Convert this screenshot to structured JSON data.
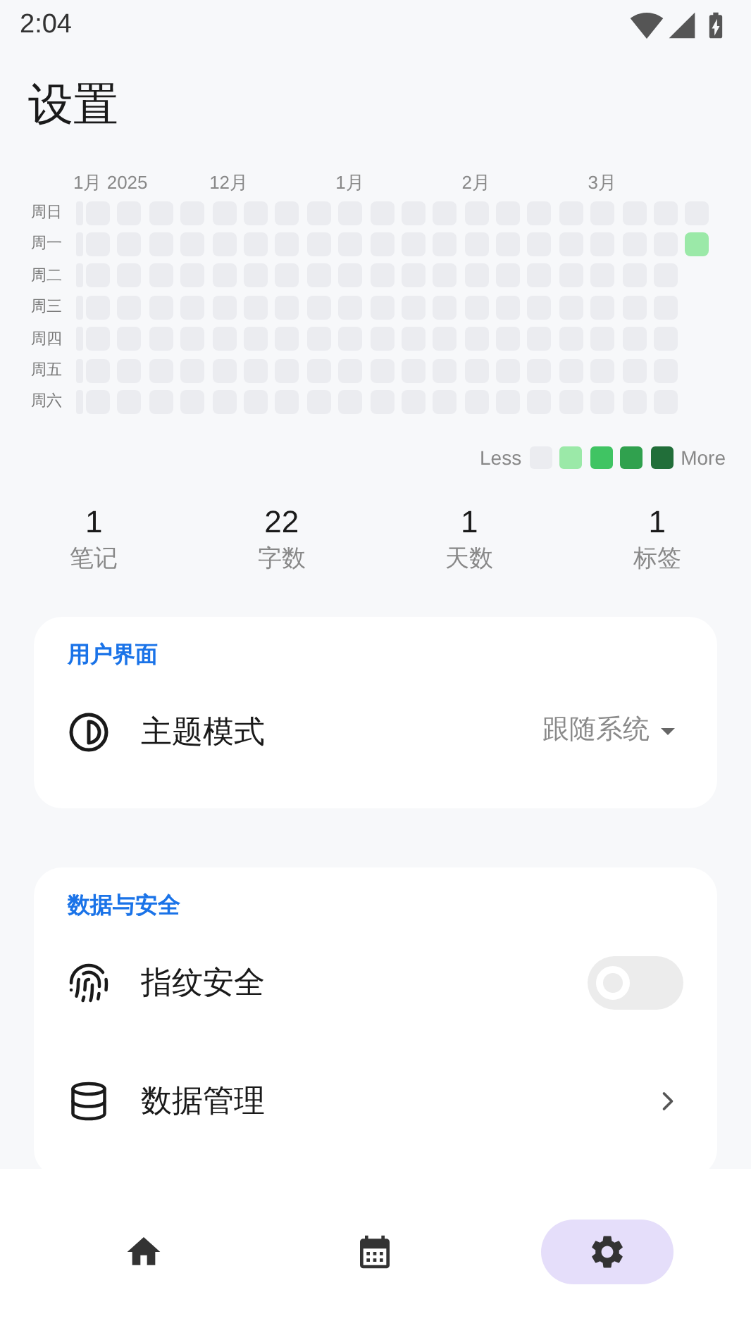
{
  "status_bar": {
    "time": "2:04"
  },
  "title": "设置",
  "heatmap": {
    "weekdays": [
      "周日",
      "周一",
      "周二",
      "周三",
      "周四",
      "周五",
      "周六"
    ],
    "weeks": [
      {
        "month_label": "1月 2025",
        "cells": [
          {
            "color": "#ebecf0"
          },
          {
            "color": "#ebecf0"
          },
          {
            "color": "#ebecf0"
          },
          {
            "color": "#ebecf0"
          },
          {
            "color": "#ebecf0"
          },
          {
            "color": "#ebecf0"
          },
          {
            "color": "#ebecf0"
          }
        ]
      },
      {
        "cells": [
          {
            "color": "#ebecf0"
          },
          {
            "color": "#ebecf0"
          },
          {
            "color": "#ebecf0"
          },
          {
            "color": "#ebecf0"
          },
          {
            "color": "#ebecf0"
          },
          {
            "color": "#ebecf0"
          },
          {
            "color": "#ebecf0"
          }
        ]
      },
      {
        "cells": [
          {
            "color": "#ebecf0"
          },
          {
            "color": "#ebecf0"
          },
          {
            "color": "#ebecf0"
          },
          {
            "color": "#ebecf0"
          },
          {
            "color": "#ebecf0"
          },
          {
            "color": "#ebecf0"
          },
          {
            "color": "#ebecf0"
          }
        ]
      },
      {
        "cells": [
          {
            "color": "#ebecf0"
          },
          {
            "color": "#ebecf0"
          },
          {
            "color": "#ebecf0"
          },
          {
            "color": "#ebecf0"
          },
          {
            "color": "#ebecf0"
          },
          {
            "color": "#ebecf0"
          },
          {
            "color": "#ebecf0"
          }
        ]
      },
      {
        "cells": [
          {
            "color": "#ebecf0"
          },
          {
            "color": "#ebecf0"
          },
          {
            "color": "#ebecf0"
          },
          {
            "color": "#ebecf0"
          },
          {
            "color": "#ebecf0"
          },
          {
            "color": "#ebecf0"
          },
          {
            "color": "#ebecf0"
          }
        ]
      },
      {
        "month_label": "12月",
        "cells": [
          {
            "color": "#ebecf0"
          },
          {
            "color": "#ebecf0"
          },
          {
            "color": "#ebecf0"
          },
          {
            "color": "#ebecf0"
          },
          {
            "color": "#ebecf0"
          },
          {
            "color": "#ebecf0"
          },
          {
            "color": "#ebecf0"
          }
        ]
      },
      {
        "cells": [
          {
            "color": "#ebecf0"
          },
          {
            "color": "#ebecf0"
          },
          {
            "color": "#ebecf0"
          },
          {
            "color": "#ebecf0"
          },
          {
            "color": "#ebecf0"
          },
          {
            "color": "#ebecf0"
          },
          {
            "color": "#ebecf0"
          }
        ]
      },
      {
        "cells": [
          {
            "color": "#ebecf0"
          },
          {
            "color": "#ebecf0"
          },
          {
            "color": "#ebecf0"
          },
          {
            "color": "#ebecf0"
          },
          {
            "color": "#ebecf0"
          },
          {
            "color": "#ebecf0"
          },
          {
            "color": "#ebecf0"
          }
        ]
      },
      {
        "cells": [
          {
            "color": "#ebecf0"
          },
          {
            "color": "#ebecf0"
          },
          {
            "color": "#ebecf0"
          },
          {
            "color": "#ebecf0"
          },
          {
            "color": "#ebecf0"
          },
          {
            "color": "#ebecf0"
          },
          {
            "color": "#ebecf0"
          }
        ]
      },
      {
        "month_label": "1月",
        "cells": [
          {
            "color": "#ebecf0"
          },
          {
            "color": "#ebecf0"
          },
          {
            "color": "#ebecf0"
          },
          {
            "color": "#ebecf0"
          },
          {
            "color": "#ebecf0"
          },
          {
            "color": "#ebecf0"
          },
          {
            "color": "#ebecf0"
          }
        ]
      },
      {
        "cells": [
          {
            "color": "#ebecf0"
          },
          {
            "color": "#ebecf0"
          },
          {
            "color": "#ebecf0"
          },
          {
            "color": "#ebecf0"
          },
          {
            "color": "#ebecf0"
          },
          {
            "color": "#ebecf0"
          },
          {
            "color": "#ebecf0"
          }
        ]
      },
      {
        "cells": [
          {
            "color": "#ebecf0"
          },
          {
            "color": "#ebecf0"
          },
          {
            "color": "#ebecf0"
          },
          {
            "color": "#ebecf0"
          },
          {
            "color": "#ebecf0"
          },
          {
            "color": "#ebecf0"
          },
          {
            "color": "#ebecf0"
          }
        ]
      },
      {
        "cells": [
          {
            "color": "#ebecf0"
          },
          {
            "color": "#ebecf0"
          },
          {
            "color": "#ebecf0"
          },
          {
            "color": "#ebecf0"
          },
          {
            "color": "#ebecf0"
          },
          {
            "color": "#ebecf0"
          },
          {
            "color": "#ebecf0"
          }
        ]
      },
      {
        "month_label": "2月",
        "cells": [
          {
            "color": "#ebecf0"
          },
          {
            "color": "#ebecf0"
          },
          {
            "color": "#ebecf0"
          },
          {
            "color": "#ebecf0"
          },
          {
            "color": "#ebecf0"
          },
          {
            "color": "#ebecf0"
          },
          {
            "color": "#ebecf0"
          }
        ]
      },
      {
        "cells": [
          {
            "color": "#ebecf0"
          },
          {
            "color": "#ebecf0"
          },
          {
            "color": "#ebecf0"
          },
          {
            "color": "#ebecf0"
          },
          {
            "color": "#ebecf0"
          },
          {
            "color": "#ebecf0"
          },
          {
            "color": "#ebecf0"
          }
        ]
      },
      {
        "cells": [
          {
            "color": "#ebecf0"
          },
          {
            "color": "#ebecf0"
          },
          {
            "color": "#ebecf0"
          },
          {
            "color": "#ebecf0"
          },
          {
            "color": "#ebecf0"
          },
          {
            "color": "#ebecf0"
          },
          {
            "color": "#ebecf0"
          }
        ]
      },
      {
        "cells": [
          {
            "color": "#ebecf0"
          },
          {
            "color": "#ebecf0"
          },
          {
            "color": "#ebecf0"
          },
          {
            "color": "#ebecf0"
          },
          {
            "color": "#ebecf0"
          },
          {
            "color": "#ebecf0"
          },
          {
            "color": "#ebecf0"
          }
        ]
      },
      {
        "month_label": "3月",
        "cells": [
          {
            "color": "#ebecf0"
          },
          {
            "color": "#ebecf0"
          },
          {
            "color": "#ebecf0"
          },
          {
            "color": "#ebecf0"
          },
          {
            "color": "#ebecf0"
          },
          {
            "color": "#ebecf0"
          },
          {
            "color": "#ebecf0"
          }
        ]
      },
      {
        "cells": [
          {
            "color": "#ebecf0"
          },
          {
            "color": "#ebecf0"
          },
          {
            "color": "#ebecf0"
          },
          {
            "color": "#ebecf0"
          },
          {
            "color": "#ebecf0"
          },
          {
            "color": "#ebecf0"
          },
          {
            "color": "#ebecf0"
          }
        ]
      },
      {
        "cells": [
          {
            "color": "#ebecf0"
          },
          {
            "color": "#ebecf0"
          },
          {
            "color": "#ebecf0"
          },
          {
            "color": "#ebecf0"
          },
          {
            "color": "#ebecf0"
          },
          {
            "color": "#ebecf0"
          },
          {
            "color": "#ebecf0"
          }
        ]
      },
      {
        "cells": [
          {
            "color": "#ebecf0"
          },
          {
            "color": "#9be9a8"
          }
        ]
      }
    ],
    "legend": {
      "less": "Less",
      "more": "More",
      "swatches": [
        {
          "color": "#ebecf0"
        },
        {
          "color": "#9be9a8"
        },
        {
          "color": "#40c463"
        },
        {
          "color": "#30a14e"
        },
        {
          "color": "#216e39"
        }
      ]
    }
  },
  "stats": [
    {
      "value": "1",
      "label": "笔记"
    },
    {
      "value": "22",
      "label": "字数"
    },
    {
      "value": "1",
      "label": "天数"
    },
    {
      "value": "1",
      "label": "标签"
    }
  ],
  "sections": [
    {
      "title": "用户界面",
      "items": [
        {
          "kind": "select",
          "label": "主题模式",
          "value": "跟随系统"
        }
      ]
    },
    {
      "title": "数据与安全",
      "items": [
        {
          "kind": "switch",
          "label": "指纹安全",
          "on": false
        },
        {
          "kind": "link",
          "label": "数据管理"
        }
      ]
    }
  ],
  "bottom_nav": [
    {
      "selected": false
    },
    {
      "selected": false
    },
    {
      "selected": true
    }
  ]
}
